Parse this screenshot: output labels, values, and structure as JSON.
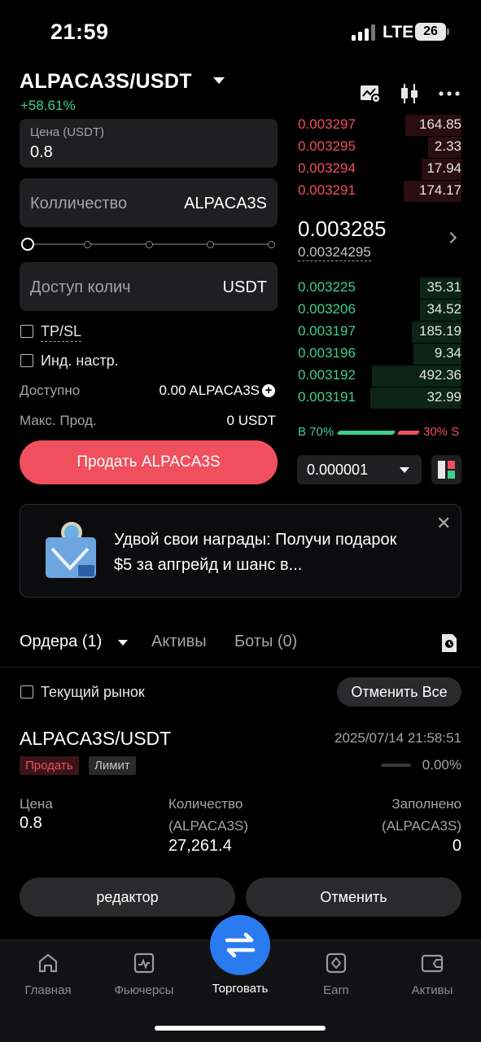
{
  "status_bar": {
    "time": "21:59",
    "network": "LTE",
    "battery": "26"
  },
  "header": {
    "pair": "ALPACA3S/USDT",
    "change": "+58.61%"
  },
  "order_form": {
    "price_label": "Цена (USDT)",
    "price_value": "0.8",
    "quantity_label": "Колличество",
    "quantity_unit": "ALPACA3S",
    "available_qty_label": "Доступ колич",
    "available_qty_unit": "USDT",
    "tpsl_label": "TP/SL",
    "custom_settings_label": "Инд. настр.",
    "available_label": "Доступно",
    "available_value": "0.00 ALPACA3S",
    "max_sell_label": "Макс. Прод.",
    "max_sell_value": "0 USDT",
    "sell_button": "Продать ALPACA3S"
  },
  "order_book": {
    "asks": [
      {
        "price": "0.003297",
        "qty": "164.85",
        "depth": 0.34
      },
      {
        "price": "0.003295",
        "qty": "2.33",
        "depth": 0.2
      },
      {
        "price": "0.003294",
        "qty": "17.94",
        "depth": 0.24
      },
      {
        "price": "0.003291",
        "qty": "174.17",
        "depth": 0.35
      }
    ],
    "last_price": "0.003285",
    "mark_price": "0.00324295",
    "bids": [
      {
        "price": "0.003225",
        "qty": "35.31",
        "depth": 0.25
      },
      {
        "price": "0.003206",
        "qty": "34.52",
        "depth": 0.25
      },
      {
        "price": "0.003197",
        "qty": "185.19",
        "depth": 0.3
      },
      {
        "price": "0.003196",
        "qty": "9.34",
        "depth": 0.29
      },
      {
        "price": "0.003192",
        "qty": "492.36",
        "depth": 0.54
      },
      {
        "price": "0.003191",
        "qty": "32.99",
        "depth": 0.55
      }
    ],
    "buy_ratio": "B 70%",
    "sell_ratio": "30% S",
    "precision": "0.000001"
  },
  "promo": {
    "text": "Удвой свои награды: Получи подарок $5 за апгрейд и шанс в..."
  },
  "tabs": {
    "orders": "Ордера (1)",
    "assets": "Активы",
    "bots": "Боты (0)"
  },
  "filters": {
    "current_market": "Текущий рынок",
    "cancel_all": "Отменить Все"
  },
  "order": {
    "pair": "ALPACA3S/USDT",
    "time": "2025/07/14 21:58:51",
    "side": "Продать",
    "type": "Лимит",
    "filled_pct": "0.00%",
    "price_label": "Цена",
    "price_value": "0.8",
    "qty_label_1": "Количество",
    "qty_label_2": "(ALPACA3S)",
    "qty_value": "27,261.4",
    "filled_label_1": "Заполнено",
    "filled_label_2": "(ALPACA3S)",
    "filled_value": "0",
    "edit_button": "редактор",
    "cancel_button": "Отменить"
  },
  "nav": {
    "home": "Главная",
    "futures": "Фьючерсы",
    "trade": "Торговать",
    "earn": "Earn",
    "assets": "Активы"
  },
  "colors": {
    "green": "#3ecf8e",
    "red": "#f0505e",
    "accent": "#2a7af0"
  }
}
